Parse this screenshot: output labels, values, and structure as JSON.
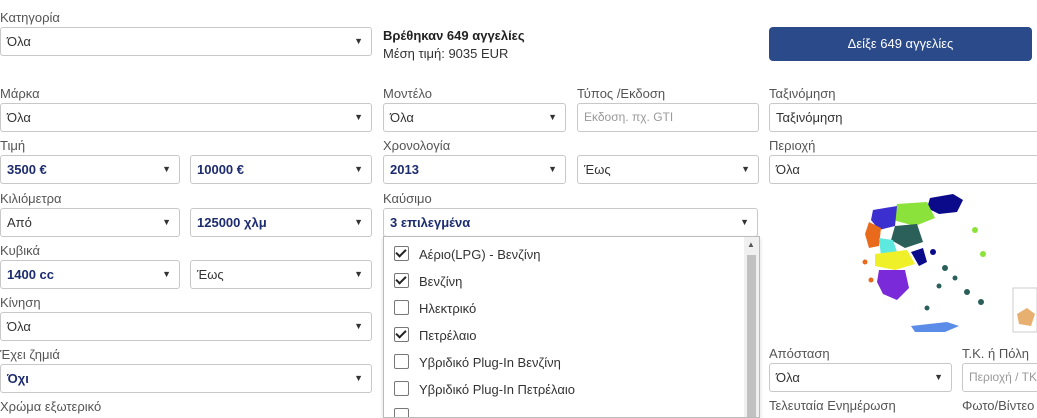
{
  "category": {
    "label": "Κατηγορία",
    "value": "Όλα"
  },
  "summary": {
    "found": "Βρέθηκαν 649 αγγελίες",
    "avg_price": "Μέση τιμή: 9035 EUR"
  },
  "show_button": "Δείξε 649 αγγελίες",
  "brand": {
    "label": "Μάρκα",
    "value": "Όλα"
  },
  "model": {
    "label": "Μοντέλο",
    "value": "Όλα"
  },
  "type": {
    "label": "Τύπος /Εκδοση",
    "placeholder": "Εκδοση. πχ. GTI"
  },
  "sort": {
    "label": "Ταξινόμηση",
    "value": "Ταξινόμηση"
  },
  "price": {
    "label": "Τιμή",
    "from": "3500 €",
    "to": "10000 €"
  },
  "year": {
    "label": "Χρονολογία",
    "from": "2013",
    "to": "Έως"
  },
  "area": {
    "label": "Περιοχή",
    "value": "Όλα"
  },
  "km": {
    "label": "Κιλιόμετρα",
    "from": "Από",
    "to": "125000 χλμ"
  },
  "fuel": {
    "label": "Καύσιμο",
    "value": "3 επιλεγμένα",
    "options": [
      {
        "label": "Αέριο(LPG) - Βενζίνη",
        "checked": true
      },
      {
        "label": "Βενζίνη",
        "checked": true
      },
      {
        "label": "Ηλεκτρικό",
        "checked": false
      },
      {
        "label": "Πετρέλαιο",
        "checked": true
      },
      {
        "label": "Υβριδικό Plug-In Βενζίνη",
        "checked": false
      },
      {
        "label": "Υβριδικό Plug-In Πετρέλαιο",
        "checked": false
      }
    ]
  },
  "cc": {
    "label": "Κυβικά",
    "from": "1400 cc",
    "to": "Έως"
  },
  "drive": {
    "label": "Κίνηση",
    "value": "Όλα"
  },
  "damage": {
    "label": "Έχει ζημιά",
    "value": "Όχι"
  },
  "color": {
    "label": "Χρώμα εξωτερικό"
  },
  "distance": {
    "label": "Απόσταση",
    "value": "Όλα"
  },
  "postcode": {
    "label": "Τ.Κ. ή Πόλη",
    "placeholder": "Περιοχή / ΤΚ"
  },
  "last_update": {
    "label": "Τελευταία Ενημέρωση"
  },
  "photo": {
    "label": "Φωτο/Βίντεο"
  }
}
